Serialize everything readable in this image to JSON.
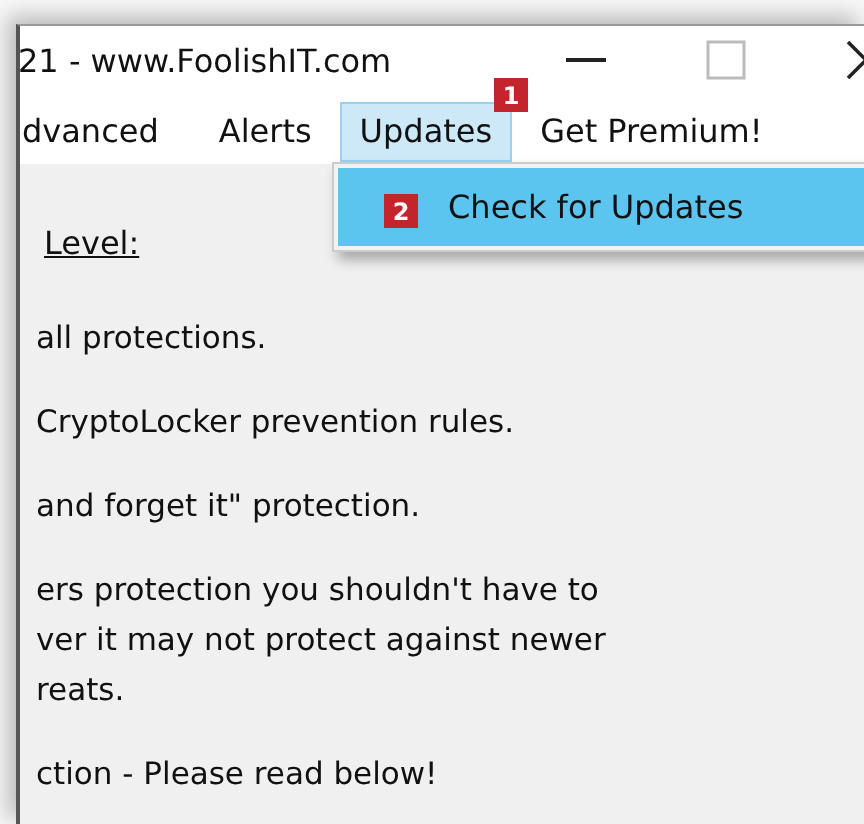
{
  "window": {
    "title": "21 - www.FoolishIT.com"
  },
  "menu": [
    {
      "label": "dvanced",
      "selected": false
    },
    {
      "label": "Alerts",
      "selected": false
    },
    {
      "label": "Updates",
      "selected": true,
      "badge": "1"
    },
    {
      "label": "Get Premium!",
      "selected": false
    }
  ],
  "dropdown": {
    "items": [
      {
        "label": "Check for Updates",
        "selected": true,
        "badge": "2"
      }
    ]
  },
  "content": {
    "heading": "Level:",
    "paragraphs": [
      [
        "all protections."
      ],
      [
        "CryptoLocker prevention rules."
      ],
      [
        "and forget it\" protection."
      ],
      [
        "ers protection you shouldn't have to",
        "ver it may not protect against newer",
        "reats."
      ],
      [
        "ction - Please read below!"
      ]
    ]
  }
}
